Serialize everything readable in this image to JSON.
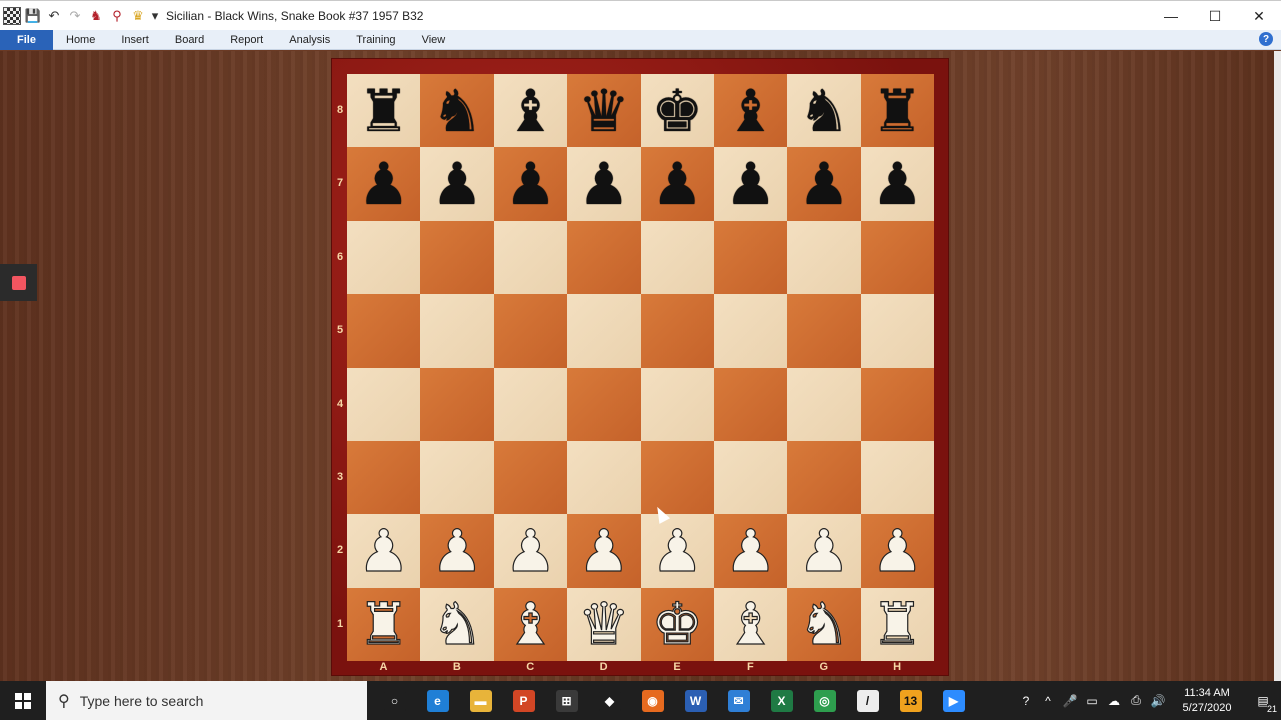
{
  "window": {
    "title": "Sicilian  - Black Wins, Snake Book #37 1957  B32",
    "controls": {
      "minimize": "—",
      "maximize": "☐",
      "close": "✕"
    }
  },
  "quick_access": {
    "save_glyph": "💾",
    "undo_glyph": "↶",
    "redo_glyph": "↷",
    "chess_glyph": "♞",
    "pin_glyph": "⚲",
    "trophy_glyph": "♛",
    "dropdown_glyph": "▾"
  },
  "ribbon": {
    "file_label": "File",
    "items": [
      "Home",
      "Insert",
      "Board",
      "Report",
      "Analysis",
      "Training",
      "View"
    ],
    "help_glyph": "?"
  },
  "board": {
    "ranks": [
      "8",
      "7",
      "6",
      "5",
      "4",
      "3",
      "2",
      "1"
    ],
    "files": [
      "A",
      "B",
      "C",
      "D",
      "E",
      "F",
      "G",
      "H"
    ],
    "position": [
      [
        "r",
        "n",
        "b",
        "q",
        "k",
        "b",
        "n",
        "r"
      ],
      [
        "p",
        "p",
        "p",
        "p",
        "p",
        "p",
        "p",
        "p"
      ],
      [
        "",
        "",
        "",
        "",
        "",
        "",
        "",
        ""
      ],
      [
        "",
        "",
        "",
        "",
        "",
        "",
        "",
        ""
      ],
      [
        "",
        "",
        "",
        "",
        "",
        "",
        "",
        ""
      ],
      [
        "",
        "",
        "",
        "",
        "",
        "",
        "",
        ""
      ],
      [
        "P",
        "P",
        "P",
        "P",
        "P",
        "P",
        "P",
        "P"
      ],
      [
        "R",
        "N",
        "B",
        "Q",
        "K",
        "B",
        "N",
        "R"
      ]
    ],
    "colors": {
      "light": "#f3dfc0",
      "dark": "#d87a3a",
      "frame": "#8a1a14"
    }
  },
  "taskbar": {
    "search_placeholder": "Type here to search",
    "search_glyph": "⚲",
    "apps": [
      {
        "name": "task-view-icon",
        "glyph": "○",
        "color": "#1f1f1f"
      },
      {
        "name": "edge-icon",
        "glyph": "e",
        "color": "#1f7fd6"
      },
      {
        "name": "file-explorer-icon",
        "glyph": "▬",
        "color": "#e8b43a"
      },
      {
        "name": "powerpoint-icon",
        "glyph": "P",
        "color": "#d24625"
      },
      {
        "name": "store-icon",
        "glyph": "⊞",
        "color": "#3a3a3a"
      },
      {
        "name": "dropbox-icon",
        "glyph": "◆",
        "color": "#1f1f1f"
      },
      {
        "name": "firefox-icon",
        "glyph": "◉",
        "color": "#e66a1f"
      },
      {
        "name": "word-icon",
        "glyph": "W",
        "color": "#2b5fb3"
      },
      {
        "name": "mail-icon",
        "glyph": "✉",
        "color": "#2f7fd6"
      },
      {
        "name": "excel-icon",
        "glyph": "X",
        "color": "#1f7a44"
      },
      {
        "name": "chrome-icon",
        "glyph": "◎",
        "color": "#2e9e4e"
      },
      {
        "name": "chessbase-icon",
        "glyph": "/",
        "color": "#ededed"
      },
      {
        "name": "app-13-icon",
        "glyph": "13",
        "color": "#f0a21e"
      },
      {
        "name": "zoom-icon",
        "glyph": "▶",
        "color": "#2d8cff"
      }
    ],
    "tray": [
      "?",
      "^",
      "🎤",
      "▭",
      "☁",
      "⎙",
      "🔊"
    ],
    "time": "11:34 AM",
    "date": "5/27/2020",
    "notification_count": "21"
  }
}
